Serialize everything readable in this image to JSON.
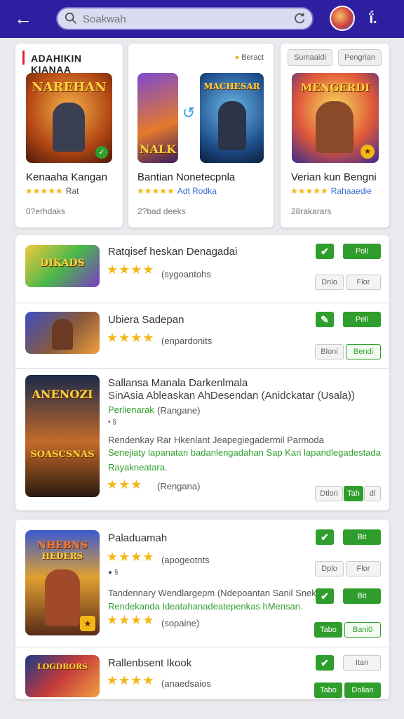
{
  "header": {
    "search_placeholder": "Soakwah",
    "top_right_label": "ḯ."
  },
  "featured": {
    "section_title": "ADAHIKIN KIANAA",
    "badge": "Beract",
    "tabs": [
      "Sumaaidi",
      "Pengrian"
    ],
    "cards": [
      {
        "name": "Kenaaha Kangan",
        "rating": "★★★★★",
        "rating_text": "Rat",
        "meta": "0?erhdaks",
        "thumb_text": "NAREHAN"
      },
      {
        "name": "Bantian Nonetecpnla",
        "rating": "★★★★★",
        "rating_text": "Adt Rodka",
        "meta": "2?bad deeks",
        "thumb_text": "MACHESAR",
        "thumb_sub": "NALK"
      },
      {
        "name": "Verian kun Bengni",
        "rating": "★★★★★",
        "rating_text": "Rahaaedie",
        "meta": "28rakarars",
        "thumb_text": "MENGERDI"
      }
    ]
  },
  "list": [
    {
      "title": "Ratqisef heskan Denagadai",
      "stars": "★★★★",
      "rating_text": "(sygoantohs",
      "btn1": "✔",
      "btn2": "Poli",
      "pill1": "Dnlo",
      "pill2": "Flor",
      "thumb_text": "DIKADS"
    },
    {
      "title": "Ubiera Sadepan",
      "stars": "★★★★",
      "rating_text": "(enpardonits",
      "btn1": "✎",
      "btn2": "Peli",
      "pill1": "Bloni",
      "pill2": "Bendi"
    },
    {
      "title": "Sallansa Manala Darkenlmala",
      "subtitle": "SinAsia Ableaskan AhDesendan (Anidckatar (Usala))",
      "green_link": "Perlienarak",
      "green_sub": "(Rangane)",
      "small_icons": "• §",
      "desc1": "Rendenkay Rar Hkenlant Jeapegiegadermil Parmoda",
      "desc2": "Senejiaty lapanatari badanlengadahan Sap Kari lapandlegadestada",
      "desc3": "Rayakneatara.",
      "stars": "★★★",
      "rating_text": "(Rengana)",
      "btn_left": "Dtlon",
      "btn_mid": "Tah",
      "btn_right": "dl",
      "thumb_text": "ANENOZI",
      "thumb_sub": "SOASCSNAS"
    },
    {
      "title": "Paladuamah",
      "stars": "★★★★",
      "rating_text": "(apogeotnts",
      "small_icons": "● §",
      "btn1": "✔",
      "btn2": "Bit",
      "pill1": "Dplo",
      "pill2": "Flor",
      "desc1": "Tandennary Wendlargepm (Ndepoantan Sanil Snekkt",
      "desc2": "Rendekanda Ideatahanadeatepenkas hMensan.",
      "btn3": "✔",
      "btn4": "Bit",
      "stars2": "★★★★",
      "rating_text2": "(sopaine)",
      "g1": "Tabo",
      "g2": "Bani0",
      "thumb_text": "NHEBNS",
      "thumb_sub": "HEDERS"
    },
    {
      "title": "Rallenbsent Ikook",
      "stars": "★★★★",
      "rating_text": "(anaedsaios",
      "btn1": "✔",
      "pill": "Itan",
      "g1": "Tabo",
      "g2": "Dolian",
      "thumb_text": "LOGDRORS"
    }
  ],
  "colors": {
    "header": "#2d1fa0",
    "accent_green": "#2f9e2c",
    "star": "#f2b714",
    "accent_red": "#e0262d"
  }
}
